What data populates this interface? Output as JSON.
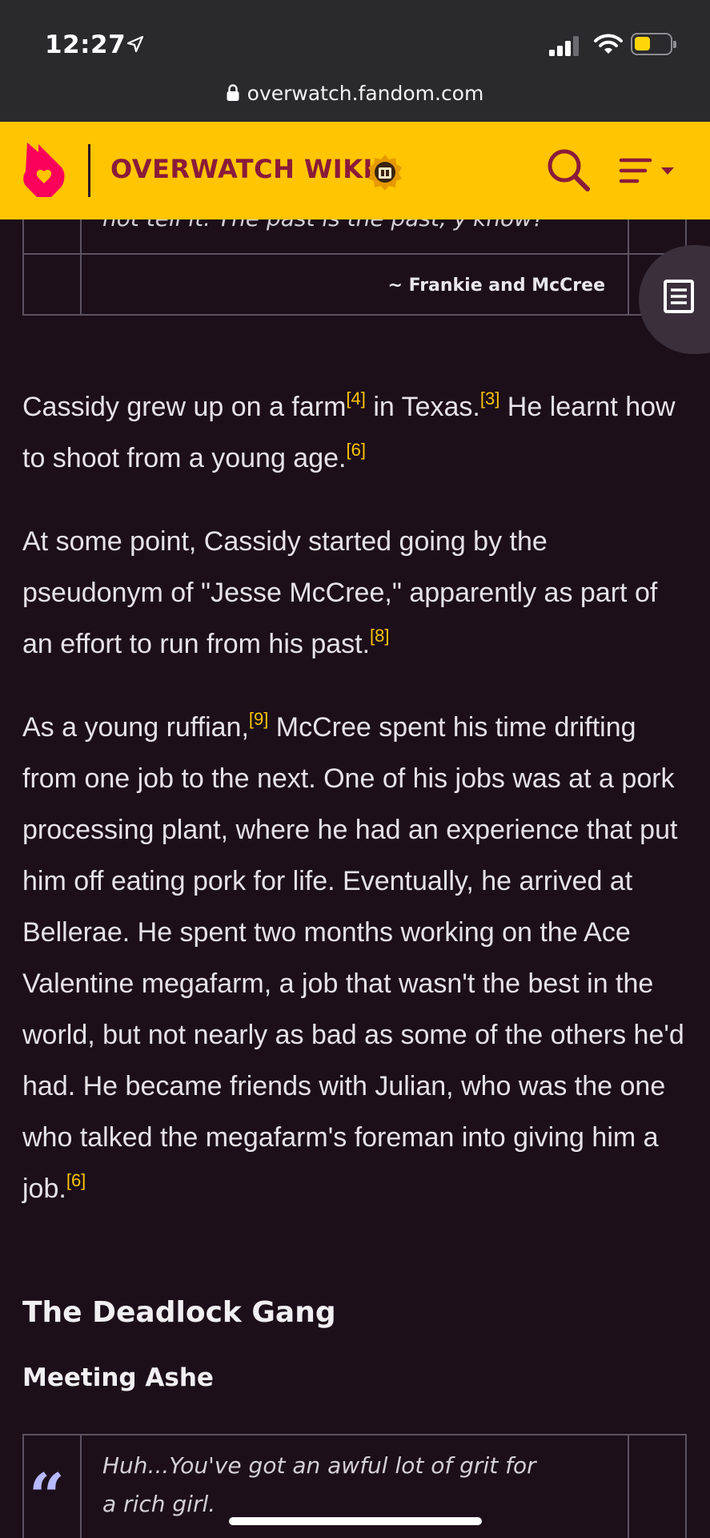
{
  "status_bar": {
    "time": "12:27",
    "battery_level": 0.4,
    "colors": {
      "battery_fill": "#ffd60a"
    }
  },
  "browser": {
    "url": "overwatch.fandom.com"
  },
  "header": {
    "wiki_title": "OVERWATCH WIKI",
    "colors": {
      "background": "#ffc500",
      "title": "#8a1b3a",
      "logo": "#fa005a"
    }
  },
  "quote_top": {
    "text": "not tell it. The past is the past, y'know?",
    "attribution": "~ Frankie and McCree"
  },
  "article": {
    "p1": {
      "a": "Cassidy grew up on a farm",
      "ref1": "[4]",
      "b": " in Texas.",
      "ref2": "[3]",
      "c": " He learnt how to shoot from a young age.",
      "ref3": "[6]"
    },
    "p2": {
      "a": "At some point, Cassidy started going by the pseudonym of \"Jesse McCree,\" apparently as part of an effort to run from his past.",
      "ref1": "[8]"
    },
    "p3": {
      "a": "As a young ruffian,",
      "ref1": "[9]",
      "b": " McCree spent his time drifting from one job to the next. One of his jobs was at a pork processing plant, where he had an experience that put him off eating pork for life. Eventually, he arrived at Bellerae. He spent two months working on the Ace Valentine megafarm, a job that wasn't the best in the world, but not nearly as bad as some of the others he'd had. He became friends with Julian, who was the one who talked the megafarm's foreman into giving him a job.",
      "ref2": "[6]"
    },
    "heading_section": "The Deadlock Gang",
    "heading_subsection": "Meeting Ashe"
  },
  "quote_bottom": {
    "text": "Huh...You've got an awful lot of grit for a rich girl."
  },
  "icons": {
    "logo": "fandom-flame-icon",
    "badge": "wiki-badge-icon",
    "search": "search-icon",
    "menu": "menu-icon",
    "toc": "table-of-contents-icon",
    "quote_open": "open-quote-icon",
    "quote_close": "close-quote-icon"
  }
}
